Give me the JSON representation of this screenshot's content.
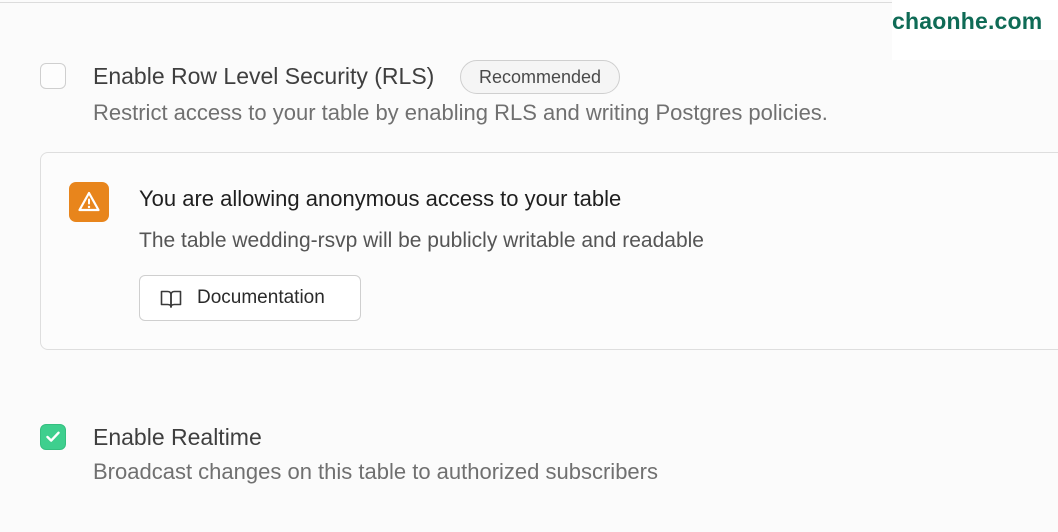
{
  "watermark": {
    "text": "chaonhe.com"
  },
  "rls": {
    "title": "Enable Row Level Security (RLS)",
    "badge": "Recommended",
    "description": "Restrict access to your table by enabling RLS and writing Postgres policies.",
    "checked": false
  },
  "warning": {
    "icon": "warning-triangle-icon",
    "title": "You are allowing anonymous access to your table",
    "body": "The table wedding-rsvp will be publicly writable and readable",
    "button_label": "Documentation",
    "button_icon": "book-icon",
    "accent_color": "#e8851c"
  },
  "realtime": {
    "title": "Enable Realtime",
    "description": "Broadcast changes on this table to authorized subscribers",
    "checked": true,
    "accent_color": "#3ecf8e"
  }
}
